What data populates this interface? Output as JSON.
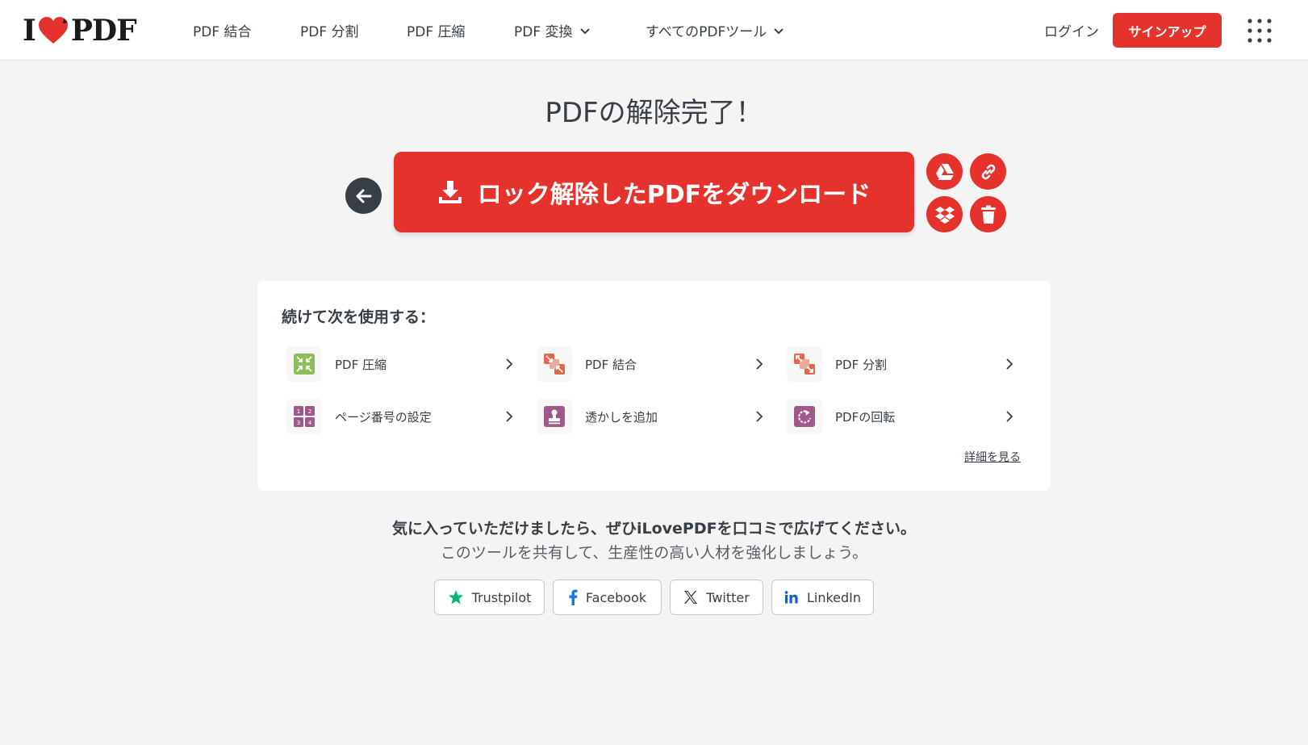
{
  "header": {
    "logo": {
      "left": "I",
      "right": "PDF"
    },
    "nav": [
      {
        "label": "PDF 結合"
      },
      {
        "label": "PDF 分割"
      },
      {
        "label": "PDF 圧縮"
      },
      {
        "label": "PDF 変換"
      },
      {
        "label": "すべてのPDFツール"
      }
    ],
    "login": "ログイン",
    "signup": "サインアップ"
  },
  "main": {
    "title": "PDFの解除完了！",
    "download": "ロック解除したPDFをダウンロード"
  },
  "continue": {
    "heading": "続けて次を使用する：",
    "tools": [
      {
        "label": "PDF 圧縮",
        "icon": "compress-icon",
        "color": "#8fbc5a"
      },
      {
        "label": "PDF 結合",
        "icon": "merge-icon",
        "color": "#e5664c"
      },
      {
        "label": "PDF 分割",
        "icon": "split-icon",
        "color": "#e5664c"
      },
      {
        "label": "ページ番号の設定",
        "icon": "page-numbers-icon",
        "color": "#a0578a"
      },
      {
        "label": "透かしを追加",
        "icon": "watermark-icon",
        "color": "#a0578a"
      },
      {
        "label": "PDFの回転",
        "icon": "rotate-icon",
        "color": "#a0578a"
      }
    ],
    "more": "詳細を見る"
  },
  "share": {
    "line1": "気に入っていただけましたら、ぜひiLovePDFを口コミで広げてください。",
    "line2": "このツールを共有して、生産性の高い人材を強化しましょう。",
    "buttons": [
      {
        "label": "Trustpilot"
      },
      {
        "label": "Facebook"
      },
      {
        "label": "Twitter"
      },
      {
        "label": "LinkedIn"
      }
    ]
  },
  "colors": {
    "brand": "#e5322d",
    "text": "#383e45",
    "trustpilot": "#00b67a",
    "facebook": "#1877f2",
    "linkedin": "#0a66c2"
  }
}
